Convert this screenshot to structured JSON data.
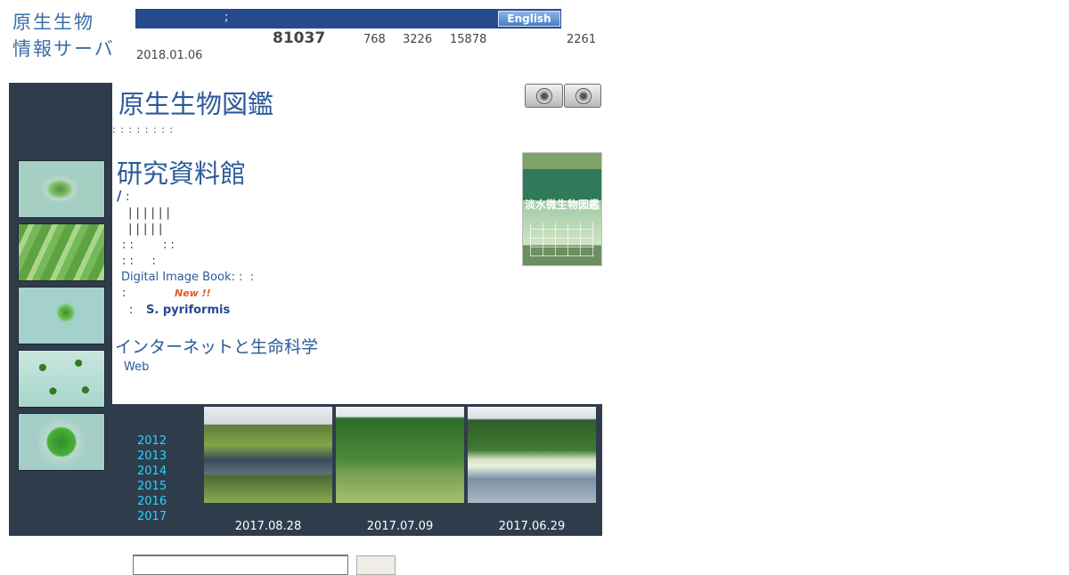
{
  "header": {
    "site_title_line1": "原生生物",
    "site_title_line2": "情報サーバ",
    "top_bar_text": ";",
    "english_button": "English",
    "counter_total": "81037",
    "counters": [
      "768",
      "3226",
      "15878",
      "2261"
    ],
    "updated_date": "2018.01.06"
  },
  "sidebar": {
    "thumbnail_icons": [
      "euglena-thumbnail",
      "diatom-thumbnail",
      "flagellate-thumbnail",
      "colony-thumbnail",
      "micrasterias-thumbnail"
    ]
  },
  "main": {
    "zukan_title": "原生生物図鑑",
    "dot_separator": ": : : : : : : :",
    "archive_title": "研究資料館",
    "book_cover_title": "淡水微生物図鑑",
    "slash_mark": "/",
    "slash_colon": ":",
    "bars_row1": "| | | | | |",
    "bars_row2": "| | | | |",
    "colons_row1": ": :        : :",
    "colons_row2": ": :     :",
    "digital_image_book": "Digital Image Book: :  :",
    "colon_row3": ":",
    "new_badge": "New !!",
    "colon_row4": ":",
    "species_link": "S. pyriformis",
    "internet_title": "インターネットと生命科学",
    "web_link": "Web"
  },
  "gallery": {
    "years": [
      "2012",
      "2013",
      "2014",
      "2015",
      "2016",
      "2017"
    ],
    "photo_dates": [
      "2017.08.28",
      "2017.07.09",
      "2017.06.29"
    ]
  },
  "colors": {
    "top_bar": "#254a8e",
    "panel": "#2f3c4c",
    "title_blue": "#2d5a9b",
    "year_link": "#27d4ff",
    "new_badge": "#e05a1f"
  }
}
